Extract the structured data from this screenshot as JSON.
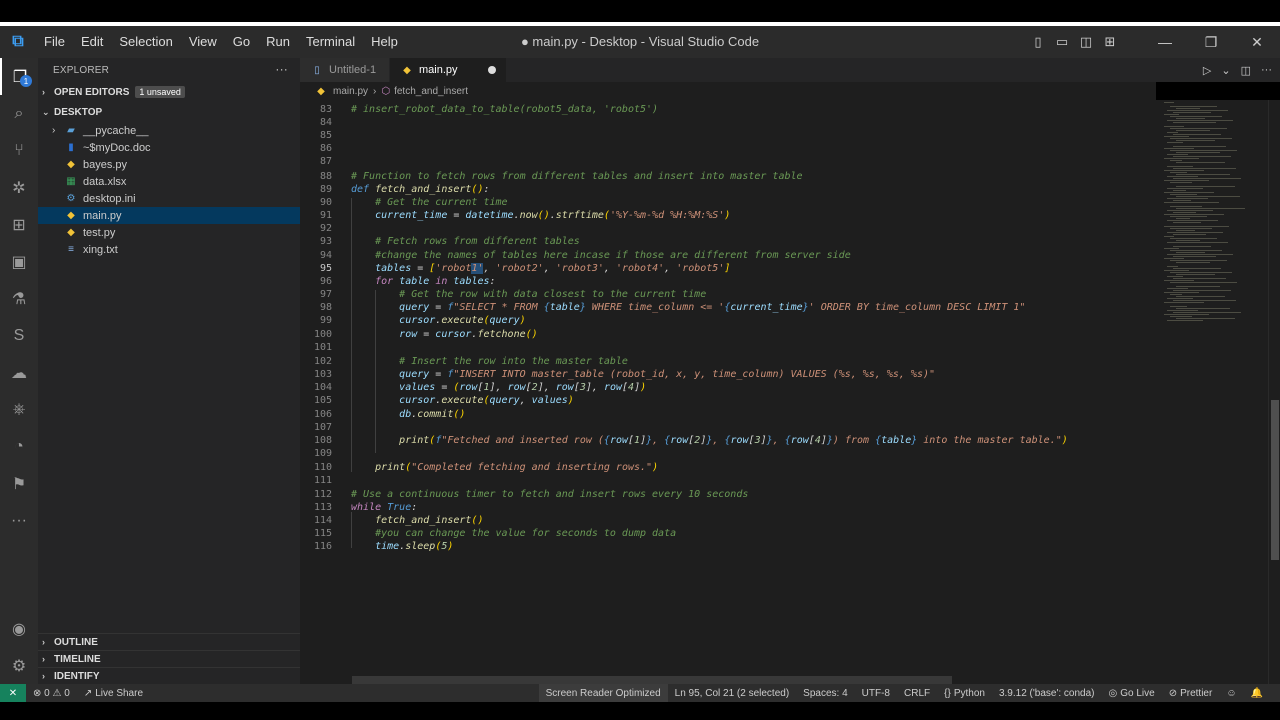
{
  "window": {
    "title": "● main.py - Desktop - Visual Studio Code",
    "menu": [
      "File",
      "Edit",
      "Selection",
      "View",
      "Go",
      "Run",
      "Terminal",
      "Help"
    ]
  },
  "activity": {
    "explorer_badge": "1"
  },
  "sidebar": {
    "header": "EXPLORER",
    "more": "···",
    "open_editors": "OPEN EDITORS",
    "unsaved_badge": "1 unsaved",
    "folder": "DESKTOP",
    "files": [
      {
        "name": "__pycache__",
        "icon": "folder-icon"
      },
      {
        "name": "~$myDoc.doc",
        "icon": "word-doc-icon"
      },
      {
        "name": "bayes.py",
        "icon": "python-icon"
      },
      {
        "name": "data.xlsx",
        "icon": "excel-icon"
      },
      {
        "name": "desktop.ini",
        "icon": "gear-icon"
      },
      {
        "name": "main.py",
        "icon": "python-icon"
      },
      {
        "name": "test.py",
        "icon": "python-icon"
      },
      {
        "name": "xing.txt",
        "icon": "text-file-icon"
      }
    ],
    "outline": "OUTLINE",
    "timeline": "TIMELINE",
    "identify": "IDENTIFY"
  },
  "tabs": [
    {
      "label": "Untitled-1"
    },
    {
      "label": "main.py"
    }
  ],
  "breadcrumb": {
    "file": "main.py",
    "symbol": "fetch_and_insert"
  },
  "editor": {
    "line_numbers": [
      "83",
      "84",
      "85",
      "86",
      "87",
      "88",
      "89",
      "90",
      "91",
      "92",
      "93",
      "94",
      "95",
      "96",
      "97",
      "98",
      "99",
      "100",
      "101",
      "102",
      "103",
      "104",
      "105",
      "106",
      "107",
      "108",
      "109",
      "110",
      "111",
      "112",
      "113",
      "114",
      "115",
      "116"
    ],
    "current_line": "95"
  },
  "status": {
    "problems": "⊗ 0 ⚠ 0",
    "live_share": "Live Share",
    "screen_reader": "Screen Reader Optimized",
    "cursor": "Ln 95, Col 21 (2 selected)",
    "spaces": "Spaces: 4",
    "encoding": "UTF-8",
    "eol": "CRLF",
    "language": "Python",
    "interpreter": "3.9.12 ('base': conda)",
    "go_live": "Go Live",
    "prettier": "Prettier"
  }
}
